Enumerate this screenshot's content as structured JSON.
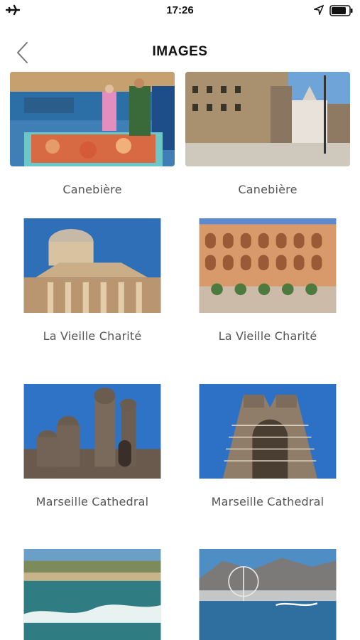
{
  "status_bar": {
    "time": "17:26",
    "battery_icon": "battery-icon",
    "location_icon": "location-arrow-icon",
    "airplane_icon": "airplane-icon"
  },
  "nav": {
    "title": "IMAGES",
    "back_icon": "chevron-left-icon"
  },
  "gallery": [
    {
      "caption": "Canebière"
    },
    {
      "caption": "Canebière"
    },
    {
      "caption": "La Vieille Charité"
    },
    {
      "caption": "La Vieille Charité"
    },
    {
      "caption": "Marseille Cathedral"
    },
    {
      "caption": "Marseille Cathedral"
    },
    {
      "caption": ""
    },
    {
      "caption": ""
    }
  ]
}
